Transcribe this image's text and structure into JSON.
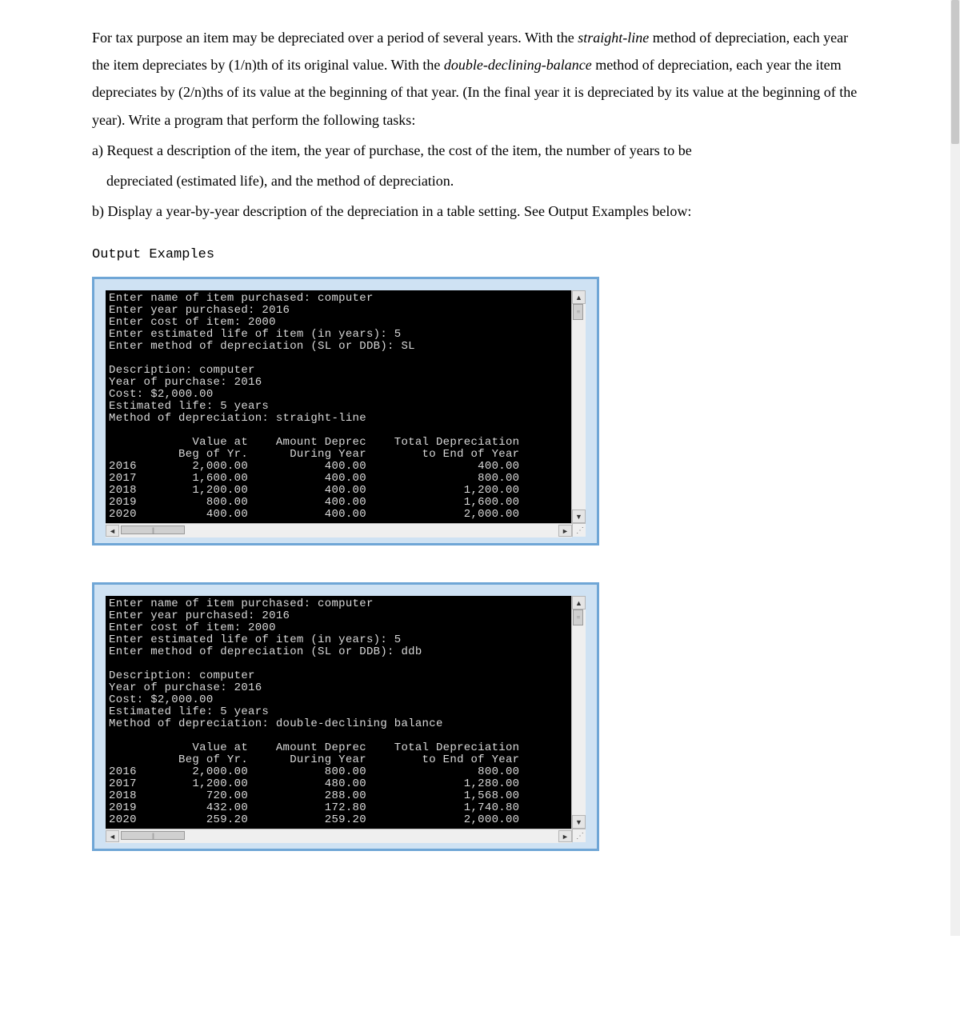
{
  "problem": {
    "p1_a": "For tax purpose an item may be depreciated over a period of several years.  With the ",
    "p1_em1": "straight-line",
    "p1_b": " method of depreciation, each year the item depreciates by (1/n)th of its original value.  With the ",
    "p1_em2": "double-declining-balance",
    "p1_c": " method of depreciation, each year the item depreciates by (2/n)ths of its value at the beginning of that year. (In the final year it is depreciated by its value at the beginning of the year).  Write a program that perform the following tasks:",
    "a": "a) Request a description of the item, the year of purchase, the cost of the item, the number of years to be",
    "a2": "depreciated (estimated life), and the method of depreciation.",
    "b": "b) Display a year-by-year description of the depreciation in a table setting.  See Output Examples below:"
  },
  "output_heading": "Output Examples",
  "examples": [
    {
      "prompts": [
        "Enter name of item purchased: computer",
        "Enter year purchased: 2016",
        "Enter cost of item: 2000",
        "Enter estimated life of item (in years): 5",
        "Enter method of depreciation (SL or DDB): SL"
      ],
      "summary": [
        "Description: computer",
        "Year of purchase: 2016",
        "Cost: $2,000.00",
        "Estimated life: 5 years",
        "Method of depreciation: straight-line"
      ],
      "table": {
        "header1": "            Value at    Amount Deprec    Total Depreciation",
        "header2": "          Beg of Yr.      During Year        to End of Year",
        "rows": [
          "2016        2,000.00           400.00                400.00",
          "2017        1,600.00           400.00                800.00",
          "2018        1,200.00           400.00              1,200.00",
          "2019          800.00           400.00              1,600.00",
          "2020          400.00           400.00              2,000.00"
        ]
      }
    },
    {
      "prompts": [
        "Enter name of item purchased: computer",
        "Enter year purchased: 2016",
        "Enter cost of item: 2000",
        "Enter estimated life of item (in years): 5",
        "Enter method of depreciation (SL or DDB): ddb"
      ],
      "summary": [
        "Description: computer",
        "Year of purchase: 2016",
        "Cost: $2,000.00",
        "Estimated life: 5 years",
        "Method of depreciation: double-declining balance"
      ],
      "table": {
        "header1": "            Value at    Amount Deprec    Total Depreciation",
        "header2": "          Beg of Yr.      During Year        to End of Year",
        "rows": [
          "2016        2,000.00           800.00                800.00",
          "2017        1,200.00           480.00              1,280.00",
          "2018          720.00           288.00              1,568.00",
          "2019          432.00           172.80              1,740.80",
          "2020          259.20           259.20              2,000.00"
        ]
      }
    }
  ],
  "scroll": {
    "up": "▲",
    "down": "▼",
    "left": "◄",
    "right": "►",
    "grip": "⋮⋮"
  }
}
